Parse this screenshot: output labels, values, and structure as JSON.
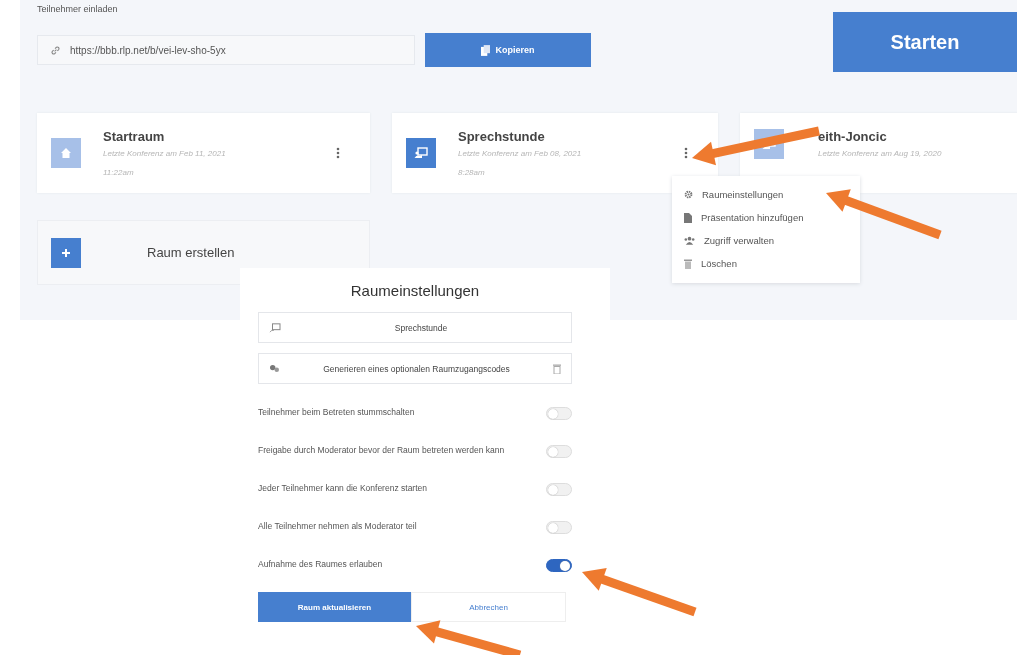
{
  "invite": {
    "label": "Teilnehmer einladen",
    "url": "https://bbb.rlp.net/b/vei-lev-sho-5yx",
    "copy_button": "Kopieren"
  },
  "start_button": "Starten",
  "rooms": [
    {
      "name": "Startraum",
      "last_conference": "Letzte Konferenz am Feb 11, 2021",
      "time": "11:22am",
      "kind": "home",
      "selected": false,
      "menu": true
    },
    {
      "name": "Sprechstunde",
      "last_conference": "Letzte Konferenz am Feb 08, 2021",
      "time": "8:28am",
      "kind": "chalkboard",
      "selected": true,
      "menu": true
    },
    {
      "name": "eith-Joncic",
      "last_conference": "Letzte Konferenz am Aug 19, 2020",
      "kind": "chalkboard",
      "selected": false,
      "menu": false
    }
  ],
  "create_room": "Raum erstellen",
  "room_menu": [
    {
      "label": "Raumeinstellungen",
      "kind": "gear"
    },
    {
      "label": "Präsentation hinzufügen",
      "kind": "file"
    },
    {
      "label": "Zugriff verwalten",
      "kind": "users"
    },
    {
      "label": "Löschen",
      "kind": "trash"
    }
  ],
  "settings_dialog": {
    "title": "Raumeinstellungen",
    "name_field": "Sprechstunde",
    "access_code_field": "Generieren eines optionalen Raumzugangscodes",
    "options": [
      {
        "label": "Teilnehmer beim Betreten stummschalten",
        "on": false
      },
      {
        "label": "Freigabe durch Moderator bevor der Raum betreten werden kann",
        "on": false
      },
      {
        "label": "Jeder Teilnehmer kann die Konferenz starten",
        "on": false
      },
      {
        "label": "Alle Teilnehmer nehmen als Moderator teil",
        "on": false
      },
      {
        "label": "Aufnahme des Raumes erlauben",
        "on": true
      }
    ],
    "update_button": "Raum aktualisieren",
    "cancel_button": "Abbrechen"
  }
}
